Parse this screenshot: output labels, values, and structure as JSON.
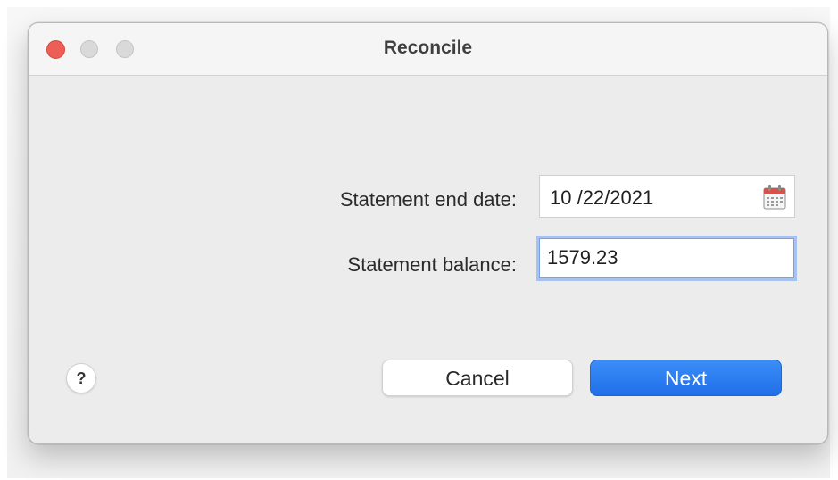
{
  "window": {
    "title": "Reconcile"
  },
  "form": {
    "statement_end_date_label": "Statement end date:",
    "statement_end_date_value": "10 /22/2021",
    "statement_balance_label": "Statement balance:",
    "statement_balance_value": "1579.23"
  },
  "buttons": {
    "help_label": "?",
    "cancel_label": "Cancel",
    "next_label": "Next"
  },
  "icons": {
    "calendar": "calendar-icon"
  },
  "colors": {
    "accent": "#2a7cf2",
    "close": "#ed5f56",
    "focus_ring": "#a7c2ef"
  }
}
